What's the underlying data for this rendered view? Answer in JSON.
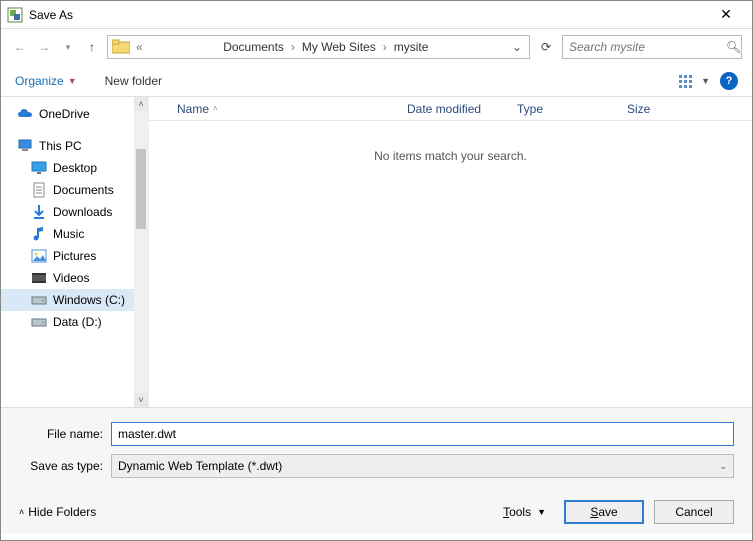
{
  "window": {
    "title": "Save As"
  },
  "breadcrumb": {
    "prefix": "«",
    "items": [
      "Documents",
      "My Web Sites",
      "mysite"
    ]
  },
  "search": {
    "placeholder": "Search mysite"
  },
  "toolbar": {
    "organize": "Organize",
    "newfolder": "New folder",
    "help_glyph": "?"
  },
  "nav": {
    "groups": [
      {
        "label": "OneDrive",
        "icon": "cloud",
        "indent": false
      },
      {
        "label": "This PC",
        "icon": "pc",
        "indent": false
      },
      {
        "label": "Desktop",
        "icon": "desktop",
        "indent": true
      },
      {
        "label": "Documents",
        "icon": "doc",
        "indent": true
      },
      {
        "label": "Downloads",
        "icon": "download",
        "indent": true
      },
      {
        "label": "Music",
        "icon": "music",
        "indent": true
      },
      {
        "label": "Pictures",
        "icon": "pictures",
        "indent": true
      },
      {
        "label": "Videos",
        "icon": "video",
        "indent": true
      },
      {
        "label": "Windows (C:)",
        "icon": "drive",
        "indent": true,
        "selected": true
      },
      {
        "label": "Data (D:)",
        "icon": "drive",
        "indent": true
      }
    ]
  },
  "columns": {
    "name": "Name",
    "date": "Date modified",
    "type": "Type",
    "size": "Size"
  },
  "empty_message": "No items match your search.",
  "form": {
    "filename_label": "File name:",
    "filename_value": "master.dwt",
    "type_label": "Save as type:",
    "type_value": "Dynamic Web Template (*.dwt)"
  },
  "footer": {
    "hide_folders": "Hide Folders",
    "tools": "Tools",
    "save": "Save",
    "cancel": "Cancel"
  }
}
